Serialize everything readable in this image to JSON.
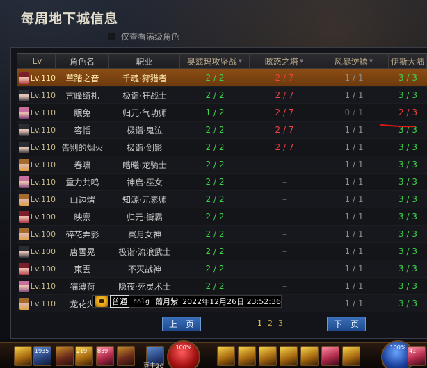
{
  "window": {
    "title": "每周地下城信息",
    "filter_label": "仅查看满级角色"
  },
  "table": {
    "headers": [
      "Lv",
      "角色名",
      "职业",
      "奥兹玛攻坚战",
      "眩惑之塔",
      "风暴逆鳞",
      "伊斯大陆"
    ],
    "rows": [
      {
        "lv": "Lv.110",
        "name": "草踏之音",
        "job": "千魂·狩猎者",
        "d1": "2 / 2",
        "d2": "2 / 7",
        "d3": "1 / 1",
        "d4": "3 / 3",
        "avatar": "avatar-red",
        "selected": true,
        "c1": "green",
        "c2": "red",
        "c3": "gray",
        "c4": "green"
      },
      {
        "lv": "Lv.110",
        "name": "言峰绮礼",
        "job": "极诣·狂战士",
        "d1": "2 / 2",
        "d2": "2 / 7",
        "d3": "1 / 1",
        "d4": "3 / 3",
        "avatar": "avatar-dark",
        "c1": "green",
        "c2": "red",
        "c3": "gray",
        "c4": "green"
      },
      {
        "lv": "Lv.110",
        "name": "眠兔",
        "job": "归元·气功师",
        "d1": "1 / 2",
        "d2": "2 / 7",
        "d3": "0 / 1",
        "d4": "2 / 3",
        "avatar": "avatar-pink",
        "c1": "green",
        "c2": "red",
        "c3": "dim",
        "c4": "red"
      },
      {
        "lv": "Lv.110",
        "name": "容恬",
        "job": "极诣·鬼泣",
        "d1": "2 / 2",
        "d2": "2 / 7",
        "d3": "1 / 1",
        "d4": "3 / 3",
        "avatar": "avatar-dark",
        "c1": "green",
        "c2": "red",
        "c3": "gray",
        "c4": "green"
      },
      {
        "lv": "Lv.110",
        "name": "告别的烟火",
        "job": "极诣·剑影",
        "d1": "2 / 2",
        "d2": "2 / 7",
        "d3": "1 / 1",
        "d4": "3 / 3",
        "avatar": "avatar-dark",
        "c1": "green",
        "c2": "red",
        "c3": "gray",
        "c4": "green"
      },
      {
        "lv": "Lv.110",
        "name": "春啸",
        "job": "皓曦·龙骑士",
        "d1": "2 / 2",
        "d2": "–",
        "d3": "1 / 1",
        "d4": "3 / 3",
        "avatar": "avatar-gold",
        "c1": "green",
        "c2": "dim",
        "c3": "gray",
        "c4": "green"
      },
      {
        "lv": "Lv.110",
        "name": "重力共鸣",
        "job": "神启·巫女",
        "d1": "2 / 2",
        "d2": "–",
        "d3": "1 / 1",
        "d4": "3 / 3",
        "avatar": "avatar-pink",
        "c1": "green",
        "c2": "dim",
        "c3": "gray",
        "c4": "green"
      },
      {
        "lv": "Lv.110",
        "name": "山边熠",
        "job": "知源·元素师",
        "d1": "2 / 2",
        "d2": "–",
        "d3": "1 / 1",
        "d4": "3 / 3",
        "avatar": "avatar-gold",
        "c1": "green",
        "c2": "dim",
        "c3": "gray",
        "c4": "green"
      },
      {
        "lv": "Lv.100",
        "name": "映禀",
        "job": "归元·街霸",
        "d1": "2 / 2",
        "d2": "–",
        "d3": "1 / 1",
        "d4": "3 / 3",
        "avatar": "avatar-red",
        "c1": "green",
        "c2": "dim",
        "c3": "gray",
        "c4": "green"
      },
      {
        "lv": "Lv.100",
        "name": "碎花弄影",
        "job": "冥月女神",
        "d1": "2 / 2",
        "d2": "–",
        "d3": "1 / 1",
        "d4": "3 / 3",
        "avatar": "avatar-gold",
        "c1": "green",
        "c2": "dim",
        "c3": "gray",
        "c4": "green"
      },
      {
        "lv": "Lv.100",
        "name": "唐雪晃",
        "job": "极诣·流浪武士",
        "d1": "2 / 2",
        "d2": "–",
        "d3": "1 / 1",
        "d4": "3 / 3",
        "avatar": "avatar-dark",
        "c1": "green",
        "c2": "dim",
        "c3": "gray",
        "c4": "green"
      },
      {
        "lv": "Lv.100",
        "name": "東雲",
        "job": "不灭战神",
        "d1": "2 / 2",
        "d2": "–",
        "d3": "1 / 1",
        "d4": "3 / 3",
        "avatar": "avatar-red",
        "c1": "green",
        "c2": "dim",
        "c3": "gray",
        "c4": "green"
      },
      {
        "lv": "Lv.110",
        "name": "猫薄荷",
        "job": "隐夜·死灵术士",
        "d1": "2 / 2",
        "d2": "–",
        "d3": "1 / 1",
        "d4": "3 / 3",
        "avatar": "avatar-pink",
        "c1": "green",
        "c2": "dim",
        "c3": "gray",
        "c4": "green"
      },
      {
        "lv": "Lv.110",
        "name": "龙花火",
        "job": "",
        "d1": "",
        "d2": "",
        "d3": "1 / 1",
        "d4": "3 / 3",
        "avatar": "avatar-gold",
        "c1": "green",
        "c2": "dim",
        "c3": "gray",
        "c4": "green"
      }
    ]
  },
  "tooltip": {
    "badge": "普通",
    "source": "colg",
    "user": "葡月紫",
    "time": "2022年12月26日 23:52:36",
    "icon": "smiley-face-icon"
  },
  "pagination": {
    "prev_label": "上一页",
    "next_label": "下一页",
    "pages": [
      "1",
      "2",
      "3"
    ],
    "current": "1"
  },
  "hotbar": {
    "hp_label": "100%",
    "mp_label": "100%",
    "counter_1": "1935",
    "counter_2": "219",
    "counter_3": "839",
    "counter_4": "41",
    "bottom_text": "豆丰20"
  },
  "colors": {
    "accent_orange": "#8a4c14",
    "success_green": "#3fd14b",
    "alert_red": "#f04040",
    "button_blue": "#2a5ca4"
  }
}
